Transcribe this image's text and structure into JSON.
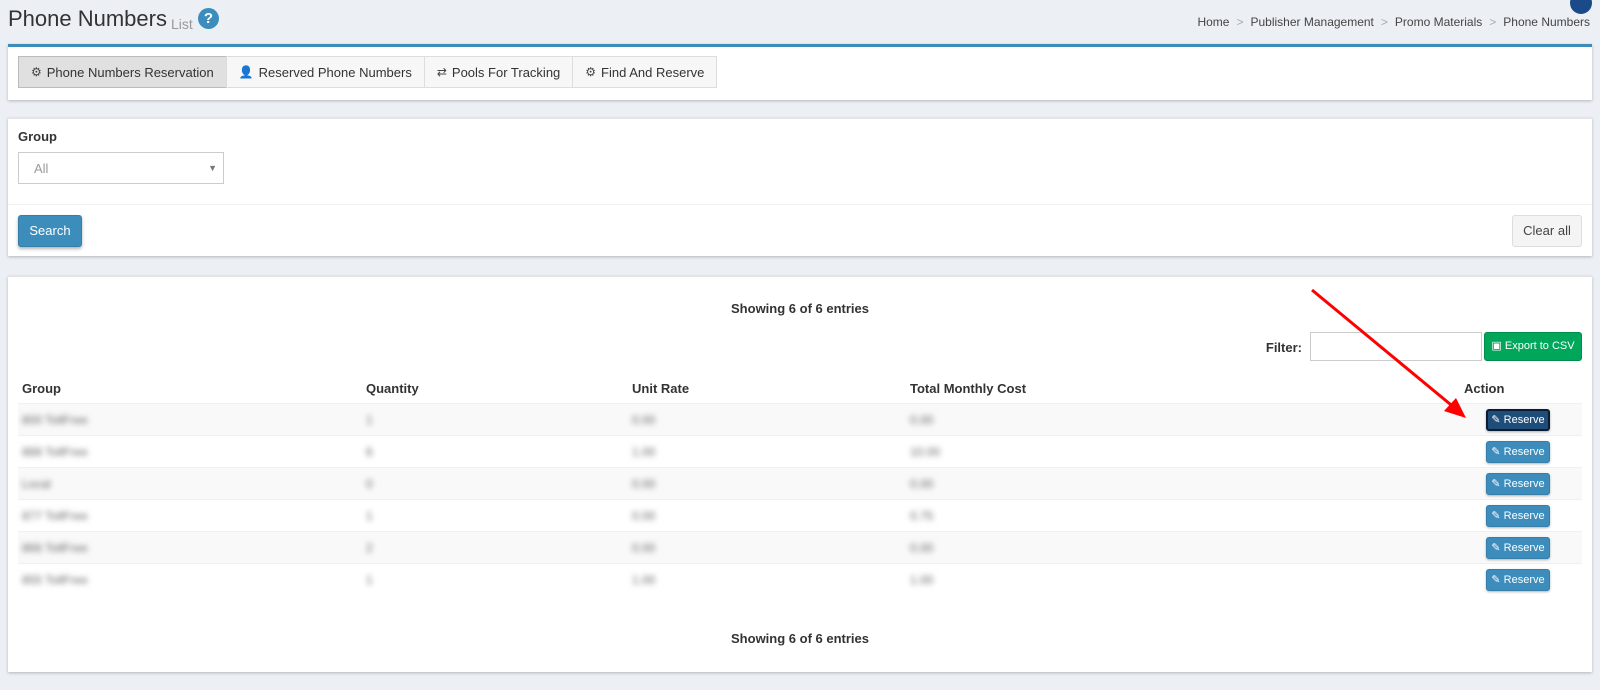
{
  "header": {
    "title": "Phone Numbers",
    "subtitle": "List",
    "help_glyph": "?",
    "breadcrumb": [
      "Home",
      "Publisher Management",
      "Promo Materials",
      "Phone Numbers"
    ],
    "breadcrumb_separator": ">"
  },
  "tabs": [
    {
      "label": "Phone Numbers Reservation",
      "icon": "gears-icon",
      "active": true
    },
    {
      "label": "Reserved Phone Numbers",
      "icon": "user-secret-icon",
      "active": false
    },
    {
      "label": "Pools For Tracking",
      "icon": "retweet-icon",
      "active": false
    },
    {
      "label": "Find And Reserve",
      "icon": "gears-icon",
      "active": false
    }
  ],
  "filters": {
    "group_label": "Group",
    "group_value": "All",
    "search_label": "Search",
    "clear_label": "Clear all"
  },
  "table": {
    "showing_text": "Showing 6 of 6 entries",
    "filter_label": "Filter:",
    "filter_value": "",
    "export_label": "Export to CSV",
    "columns": [
      "Group",
      "Quantity",
      "Unit Rate",
      "Total Monthly Cost",
      "Action"
    ],
    "reserve_label": "Reserve",
    "rows": [
      {
        "group": "800 TollFree",
        "quantity": "1",
        "unit_rate": "0.00",
        "total": "0.00"
      },
      {
        "group": "888 TollFree",
        "quantity": "6",
        "unit_rate": "1.00",
        "total": "10.00"
      },
      {
        "group": "Local",
        "quantity": "0",
        "unit_rate": "0.00",
        "total": "0.00"
      },
      {
        "group": "877 TollFree",
        "quantity": "1",
        "unit_rate": "0.00",
        "total": "0.75"
      },
      {
        "group": "866 TollFree",
        "quantity": "2",
        "unit_rate": "0.00",
        "total": "0.00"
      },
      {
        "group": "855 TollFree",
        "quantity": "1",
        "unit_rate": "1.00",
        "total": "1.00"
      }
    ]
  },
  "colors": {
    "primary": "#3c8dbc",
    "success": "#00a65a",
    "focused_button": "#1f4d7a",
    "annotation_arrow": "#ff0000"
  }
}
